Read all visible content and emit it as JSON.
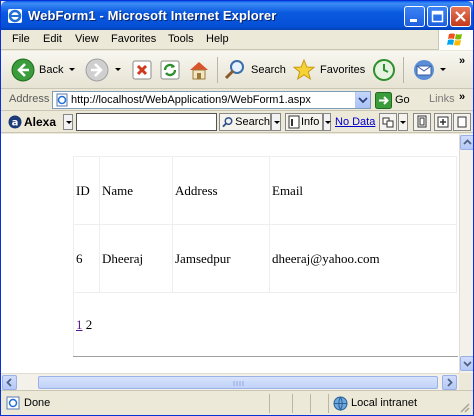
{
  "window": {
    "title": "WebForm1 - Microsoft Internet Explorer"
  },
  "menu": [
    "File",
    "Edit",
    "View",
    "Favorites",
    "Tools",
    "Help"
  ],
  "toolbar": {
    "back_label": "Back",
    "search_label": "Search",
    "favorites_label": "Favorites"
  },
  "address": {
    "label": "Address",
    "url": "http://localhost/WebApplication9/WebForm1.aspx",
    "go_label": "Go",
    "links_label": "Links"
  },
  "alexa": {
    "brand": "Alexa",
    "search_value": "",
    "search_label": "Search",
    "info_label": "Info",
    "nodata_label": "No Data"
  },
  "grid": {
    "headers": [
      "ID",
      "Name",
      "Address",
      "Email"
    ],
    "rows": [
      [
        "6",
        "Dheeraj",
        "Jamsedpur",
        "dheeraj@yahoo.com"
      ]
    ],
    "pager": {
      "link": "1",
      "current": "2"
    }
  },
  "status": {
    "text": "Done",
    "zone": "Local intranet"
  },
  "colors": {
    "titlebar": "#0a5ae0",
    "link": "#551a8b",
    "nodata": "#0000cc"
  },
  "icons": [
    "ie-icon",
    "minimize-icon",
    "maximize-icon",
    "close-icon",
    "back-arrow-icon",
    "forward-arrow-icon",
    "stop-icon",
    "refresh-icon",
    "home-icon",
    "search-icon",
    "favorites-star-icon",
    "history-icon",
    "mail-icon",
    "page-icon",
    "go-arrow-icon",
    "alexa-logo-icon",
    "globe-icon"
  ]
}
